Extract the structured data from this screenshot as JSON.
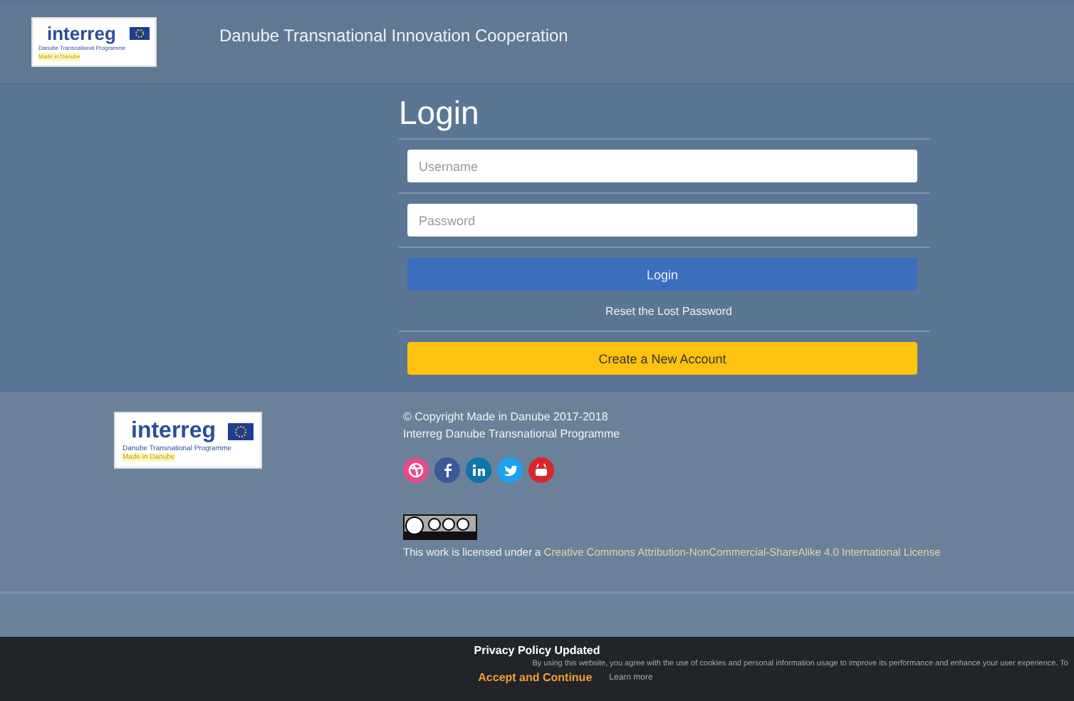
{
  "header": {
    "logo": {
      "name": "interreg",
      "subtitle": "Danube Transnational Programme",
      "tagline": "Made in Danube"
    },
    "title": "Danube Transnational Innovation Cooperation"
  },
  "login": {
    "title": "Login",
    "fields": [
      {
        "placeholder": "Username"
      },
      {
        "placeholder": "Password"
      }
    ],
    "submit": "Login",
    "reset_link": "Reset the Lost Password",
    "create_button": "Create a New Account"
  },
  "footer": {
    "logo": {
      "name": "interreg",
      "subtitle": "Danube Transnational Programme",
      "tagline": "Made in Danube"
    },
    "copyright": "© Copyright Made in Danube 2017-2018",
    "programme": "Interreg Danube Transnational Programme",
    "social": [
      {
        "kind": "dribbble",
        "color": "#e84a8a"
      },
      {
        "kind": "facebook",
        "color": "#3b5998"
      },
      {
        "kind": "linkedin",
        "color": "#0e76a8"
      },
      {
        "kind": "twitter",
        "color": "#1da1f2"
      },
      {
        "kind": "youtube",
        "color": "#d9262a"
      }
    ],
    "license_text": "This work is licensed under a ",
    "license_link": "Creative Commons Attribution-NonCommercial-ShareAlike 4.0 International License"
  },
  "cookie_bar": {
    "title": "Privacy Policy Updated",
    "message": "By using this website, you agree with the use of cookies and personal information usage to improve its performance and enhance your user experience. To",
    "accept": "Accept and Continue",
    "learn_more": "Learn more"
  }
}
